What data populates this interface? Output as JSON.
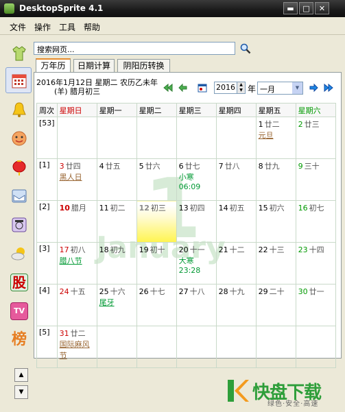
{
  "window": {
    "title": "DesktopSprite 4.1",
    "minimize_glyph": "▬",
    "maximize_glyph": "□",
    "close_glyph": "✕"
  },
  "menu": [
    "文件",
    "操作",
    "工具",
    "帮助"
  ],
  "search": {
    "value": "搜索网页..."
  },
  "tabs": [
    "万年历",
    "日期计算",
    "阴阳历转换"
  ],
  "header": {
    "date_text": "2016年1月12日 星期二 农历乙未年",
    "lunar_text": "(羊) 腊月初三",
    "year": "2016",
    "year_label": "年",
    "month": "一月"
  },
  "calendar": {
    "weekno_header": "周次",
    "weekdays": [
      "星期日",
      "星期一",
      "星期二",
      "星期三",
      "星期四",
      "星期五",
      "星期六"
    ],
    "weeks": [
      {
        "no": "[53]",
        "days": [
          null,
          null,
          null,
          null,
          null,
          {
            "d": "1",
            "l": "廿二",
            "h": "元旦",
            "hc": "brown"
          },
          {
            "d": "2",
            "l": "廿三",
            "c": "green"
          }
        ]
      },
      {
        "no": "[1]",
        "days": [
          {
            "d": "3",
            "l": "廿四",
            "c": "red",
            "h": "黑人日",
            "hc": "brown"
          },
          {
            "d": "4",
            "l": "廿五"
          },
          {
            "d": "5",
            "l": "廿六"
          },
          {
            "d": "6",
            "l": "廿七",
            "t": "小寒",
            "tt": "06:09"
          },
          {
            "d": "7",
            "l": "廿八"
          },
          {
            "d": "8",
            "l": "廿九"
          },
          {
            "d": "9",
            "l": "三十",
            "c": "green"
          }
        ]
      },
      {
        "no": "[2]",
        "days": [
          {
            "d": "10",
            "l": "腊月",
            "c": "red",
            "bold": true
          },
          {
            "d": "11",
            "l": "初二"
          },
          {
            "d": "12",
            "l": "初三",
            "today": true
          },
          {
            "d": "13",
            "l": "初四"
          },
          {
            "d": "14",
            "l": "初五"
          },
          {
            "d": "15",
            "l": "初六"
          },
          {
            "d": "16",
            "l": "初七",
            "c": "green"
          }
        ]
      },
      {
        "no": "[3]",
        "days": [
          {
            "d": "17",
            "l": "初八",
            "c": "red",
            "h": "腊八节",
            "hc": "green"
          },
          {
            "d": "18",
            "l": "初九"
          },
          {
            "d": "19",
            "l": "初十"
          },
          {
            "d": "20",
            "l": "十一",
            "t": "大寒",
            "tt": "23:28"
          },
          {
            "d": "21",
            "l": "十二"
          },
          {
            "d": "22",
            "l": "十三"
          },
          {
            "d": "23",
            "l": "十四",
            "c": "green"
          }
        ]
      },
      {
        "no": "[4]",
        "days": [
          {
            "d": "24",
            "l": "十五",
            "c": "red"
          },
          {
            "d": "25",
            "l": "十六",
            "h": "尾牙",
            "hc": "green"
          },
          {
            "d": "26",
            "l": "十七"
          },
          {
            "d": "27",
            "l": "十八"
          },
          {
            "d": "28",
            "l": "十九"
          },
          {
            "d": "29",
            "l": "二十"
          },
          {
            "d": "30",
            "l": "廿一",
            "c": "green"
          }
        ]
      },
      {
        "no": "[5]",
        "days": [
          {
            "d": "31",
            "l": "廿二",
            "c": "red",
            "h": "国际麻风节",
            "hc": "brown"
          },
          null,
          null,
          null,
          null,
          null,
          null
        ]
      }
    ]
  },
  "watermark": {
    "day": "1",
    "month": "January"
  },
  "sidebar_icons": [
    "shirt-icon",
    "calendar-icon",
    "bell-icon",
    "face-icon",
    "lantern-icon",
    "mail-icon",
    "phone-icon",
    "weather-icon",
    "stock-icon",
    "tv-icon",
    "ranking-icon"
  ],
  "sidebar_glyphs": {
    "stock": "股",
    "tv": "TV",
    "ranking": "榜"
  },
  "scroll": {
    "up": "▲",
    "down": "▼"
  },
  "brand": {
    "name": "快盘下载",
    "slogan": "绿色·安全·高速",
    "colors": {
      "green": "#2e9e3a",
      "orange": "#f39a1e"
    }
  }
}
